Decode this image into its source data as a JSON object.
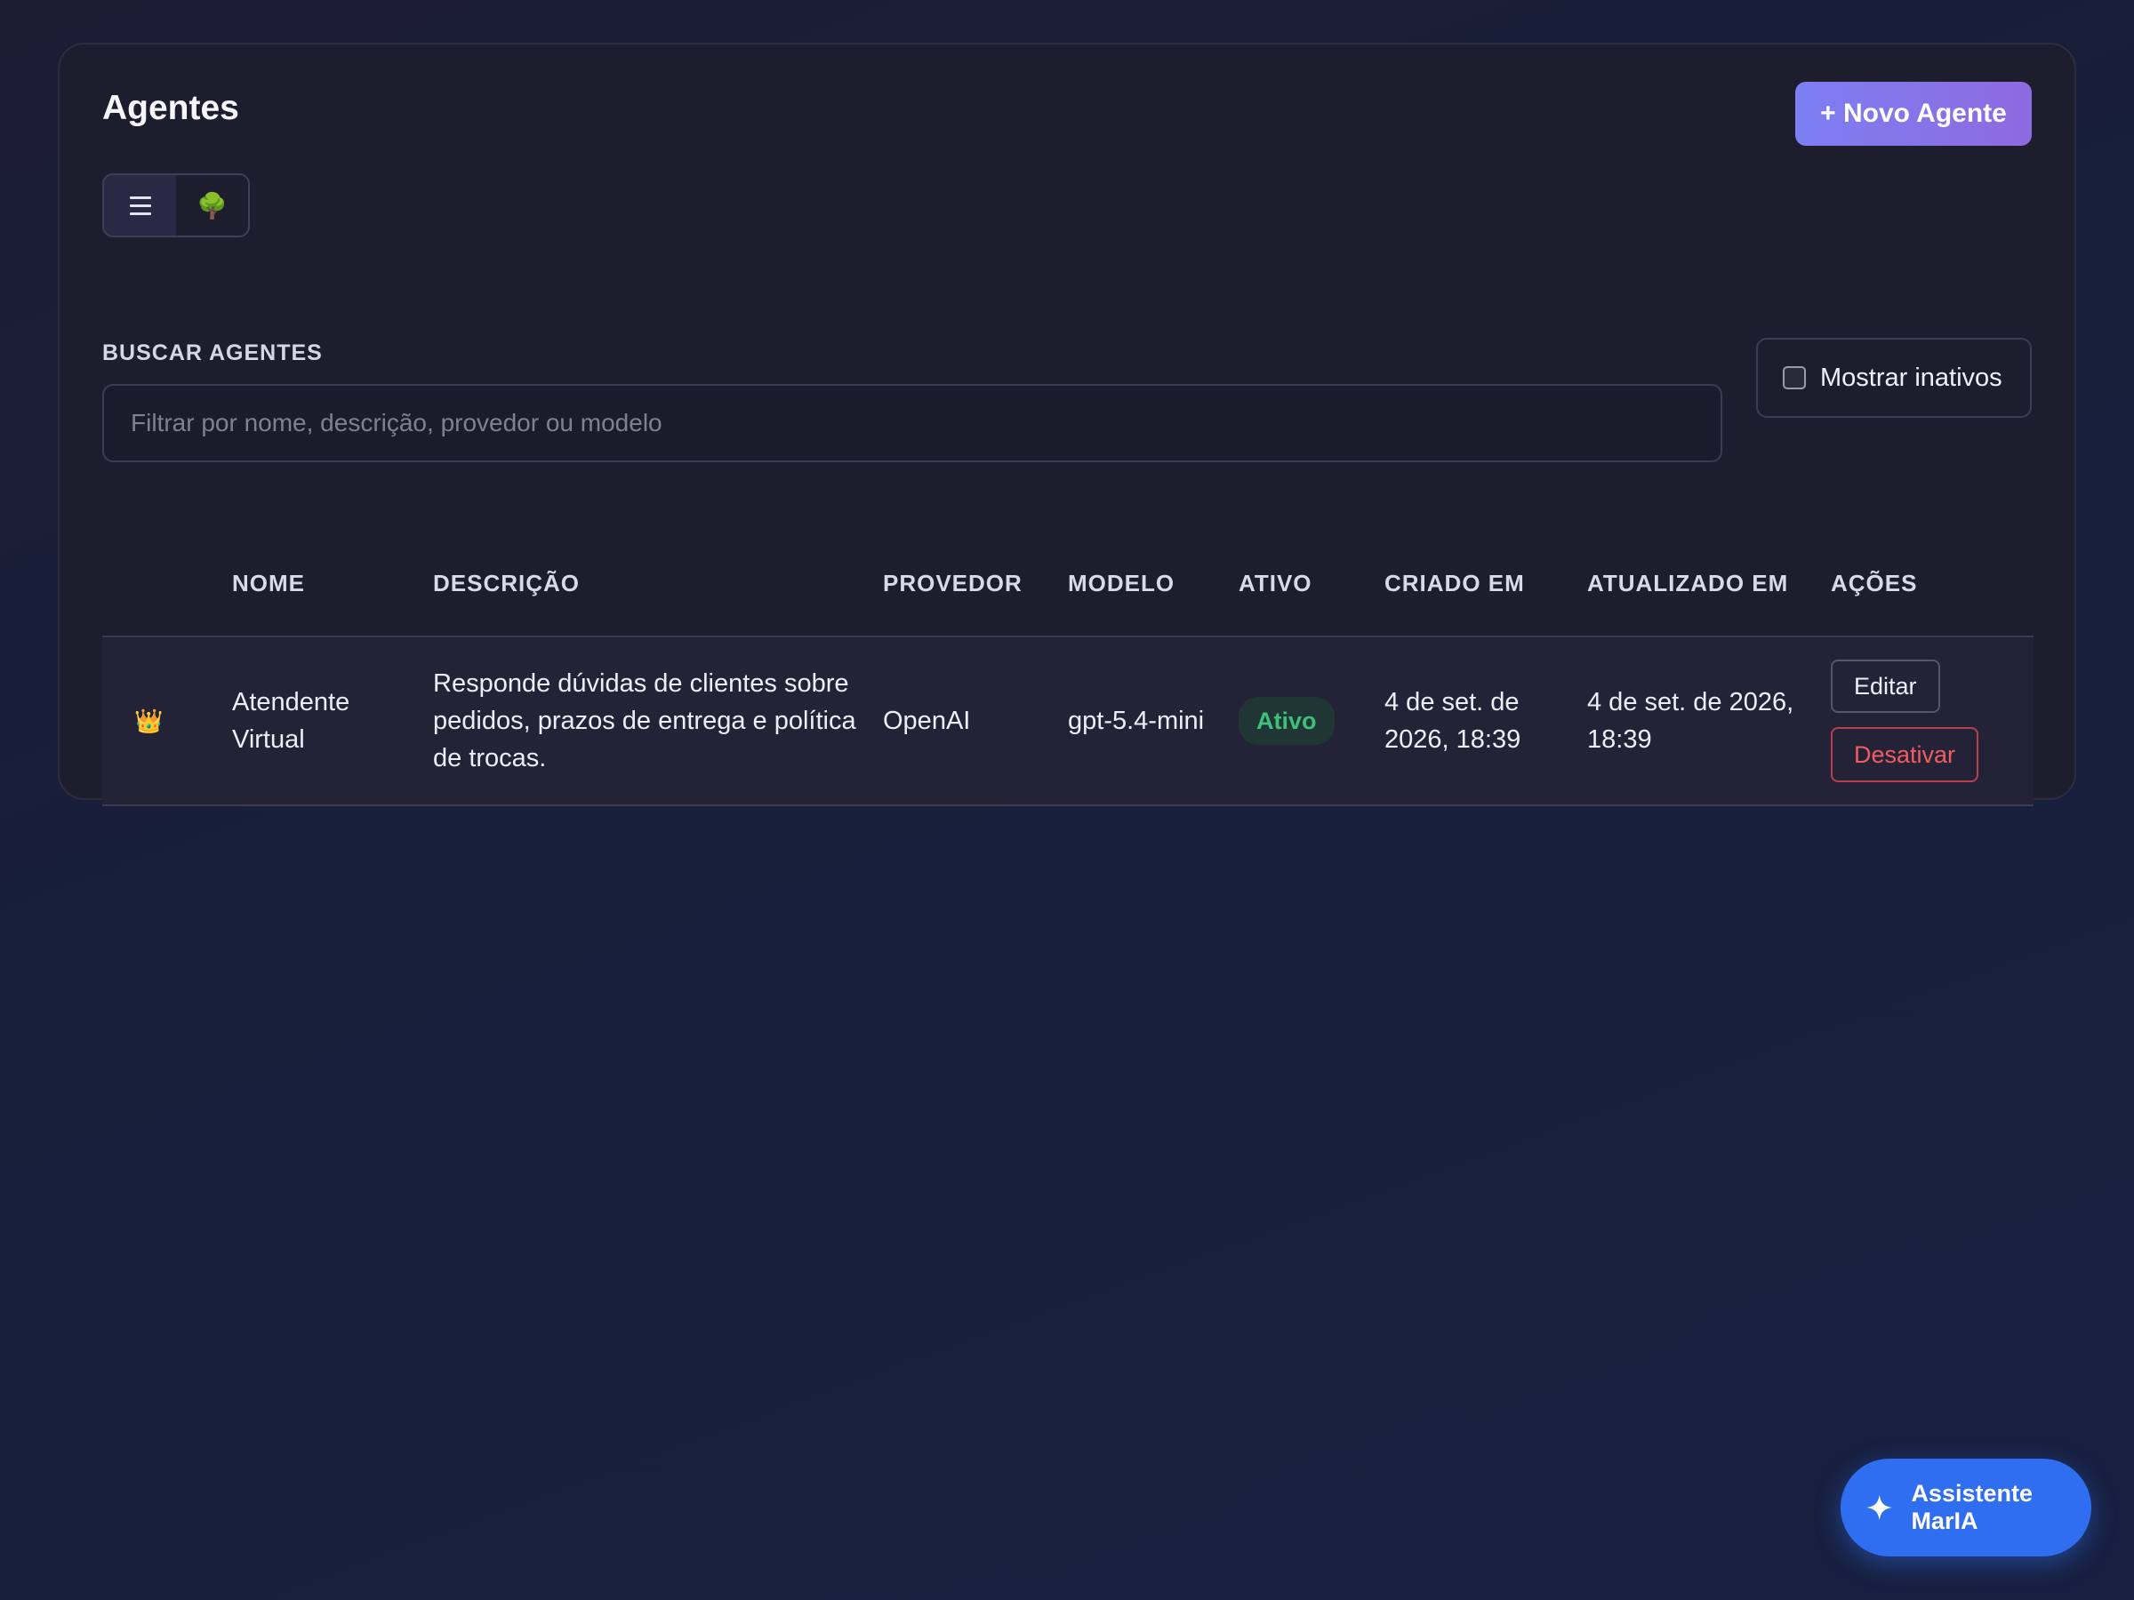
{
  "page": {
    "title": "Agentes",
    "new_button": "+ Novo Agente",
    "view_toggle": {
      "list_icon": "list-icon",
      "tree_icon": "tree-icon",
      "tree_glyph": "🌳"
    }
  },
  "search": {
    "label": "BUSCAR AGENTES",
    "placeholder": "Filtrar por nome, descrição, provedor ou modelo",
    "value": "",
    "show_inactive_label": "Mostrar inativos",
    "show_inactive_checked": false
  },
  "table": {
    "headers": [
      "",
      "NOME",
      "DESCRIÇÃO",
      "PROVEDOR",
      "MODELO",
      "ATIVO",
      "CRIADO EM",
      "ATUALIZADO EM",
      "AÇÕES"
    ],
    "rows": [
      {
        "icon": "crown-icon",
        "icon_glyph": "👑",
        "nome": "Atendente Virtual",
        "descricao": "Responde dúvidas de clientes sobre pedidos, prazos de entrega e política de trocas.",
        "provedor": "OpenAI",
        "modelo": "gpt-5.4-mini",
        "ativo": "Ativo",
        "criado_em": "4 de set. de 2026, 18:39",
        "atualizado_em": "4 de set. de 2026, 18:39",
        "acoes": {
          "edit": "Editar",
          "deactivate": "Desativar"
        }
      }
    ]
  },
  "assistant": {
    "label": "Assistente MarIA",
    "icon": "sparkle-icon"
  },
  "colors": {
    "accent_gradient_start": "#7c7ff2",
    "accent_gradient_end": "#8f69df",
    "active_badge": "#3fbf7a",
    "danger": "#ef5d60",
    "assistant_blue": "#2f6ef0"
  }
}
